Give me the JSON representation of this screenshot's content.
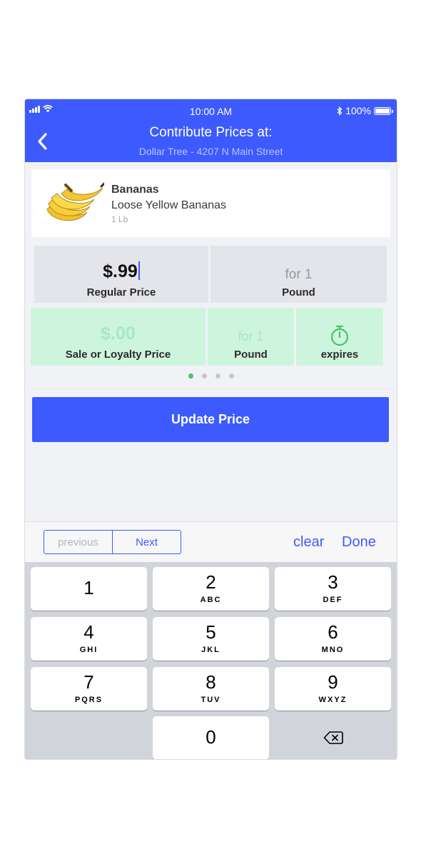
{
  "status_bar": {
    "time": "10:00 AM",
    "battery": "100%"
  },
  "header": {
    "back_icon": "chevron-left-icon",
    "title": "Contribute Prices at:",
    "store": "Dollar Tree - 4207 N Main Street"
  },
  "product": {
    "name": "Bananas",
    "description": "Loose Yellow Bananas",
    "size": "1 Lb",
    "image": "banana-image"
  },
  "regular": {
    "price": "$.99",
    "price_label": "Regular Price",
    "quantity": "for 1",
    "unit": "Pound"
  },
  "sale": {
    "price": "$.00",
    "price_label": "Sale or Loyalty Price",
    "quantity": "for 1",
    "unit": "Pound",
    "expires_label": "expires",
    "expires_icon": "stopwatch-icon"
  },
  "pager": {
    "count": 4,
    "active": 0
  },
  "update_button": "Update Price",
  "toolbar": {
    "previous": "previous",
    "next": "Next",
    "clear": "clear",
    "done": "Done"
  },
  "keypad": {
    "keys": [
      {
        "num": "1",
        "letters": ""
      },
      {
        "num": "2",
        "letters": "ABC"
      },
      {
        "num": "3",
        "letters": "DEF"
      },
      {
        "num": "4",
        "letters": "GHI"
      },
      {
        "num": "5",
        "letters": "JKL"
      },
      {
        "num": "6",
        "letters": "MNO"
      },
      {
        "num": "7",
        "letters": "PQRS"
      },
      {
        "num": "8",
        "letters": "TUV"
      },
      {
        "num": "9",
        "letters": "WXYZ"
      },
      {
        "num": "0",
        "letters": ""
      }
    ],
    "delete_icon": "backspace-icon"
  },
  "colors": {
    "primary": "#3d5afe",
    "sale_bg": "#cdf5dd",
    "sale_text": "#a8e7c0",
    "active_dot": "#46c36b"
  }
}
